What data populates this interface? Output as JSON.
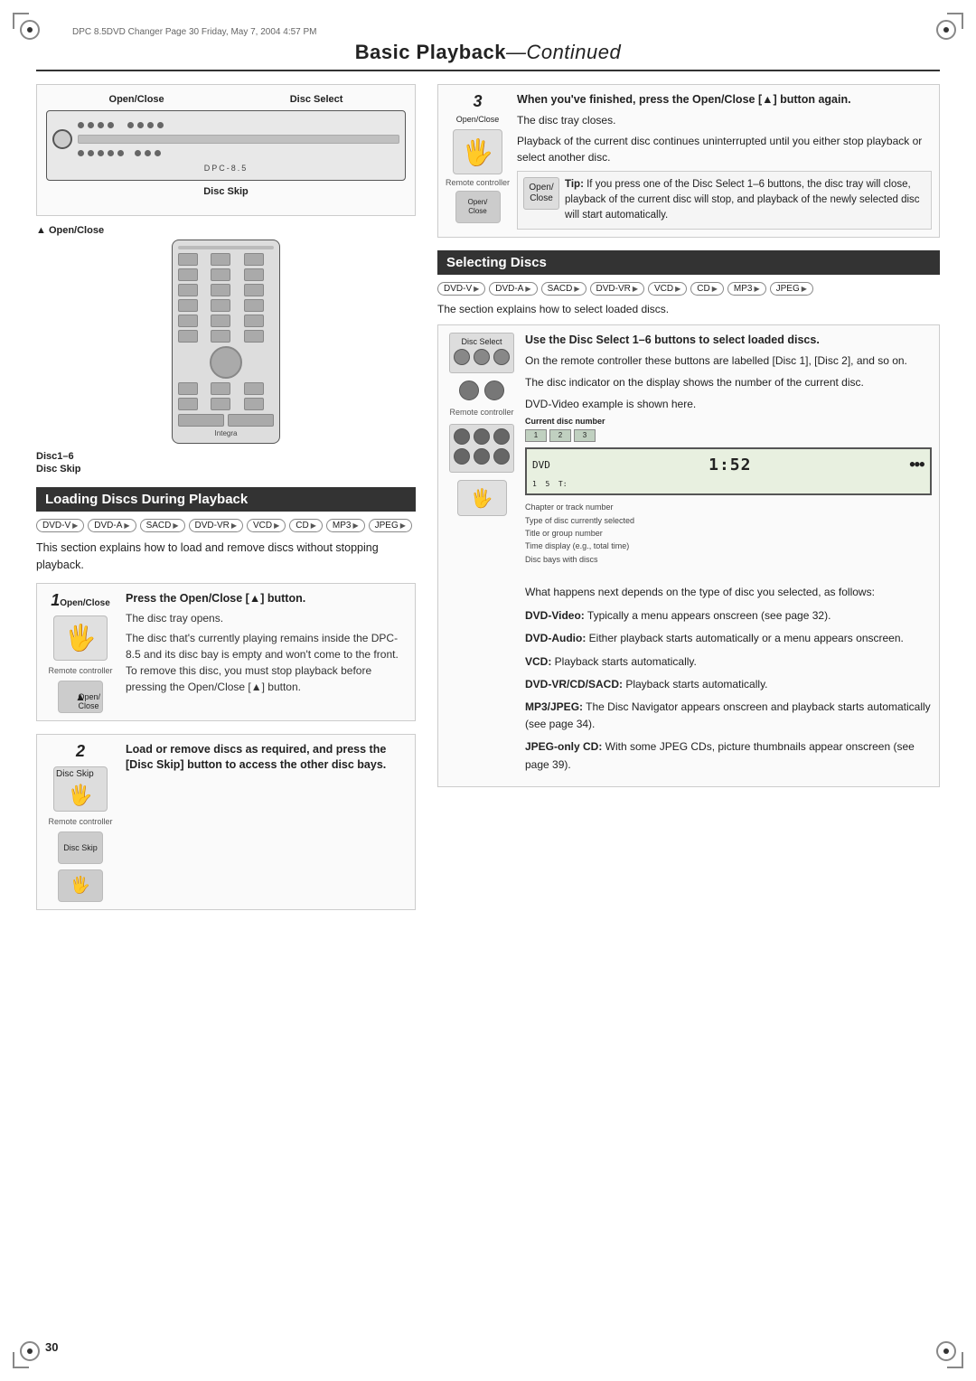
{
  "meta": {
    "header": "DPC 8.5DVD Changer  Page 30  Friday, May 7, 2004  4:57 PM"
  },
  "page_title": "Basic Playback",
  "page_title_suffix": "—Continued",
  "page_number": "30",
  "device_diagram": {
    "label_open_close": "Open/Close",
    "label_disc_select": "Disc Select",
    "label_disc_skip": "Disc Skip",
    "label_open_close_left": "▲ Open/Close",
    "label_disc1_6": "Disc1–6",
    "label_disc_skip_left": "Disc Skip"
  },
  "loading_section": {
    "title": "Loading Discs During Playback",
    "formats": [
      "DVD-V",
      "DVD-A",
      "SACD",
      "DVD-VR",
      "VCD",
      "CD",
      "MP3",
      "JPEG"
    ],
    "intro": "This section explains how to load and remove discs without stopping playback.",
    "steps": [
      {
        "number": "1",
        "icon_label": "Open/Close",
        "remote_label": "Remote controller",
        "title": "Press the Open/Close [▲] button.",
        "body_lines": [
          "The disc tray opens.",
          "The disc that's currently playing remains inside the DPC-8.5 and its disc bay is empty and won't come to the front. To remove this disc, you must stop playback before pressing the Open/Close [▲] button."
        ]
      },
      {
        "number": "2",
        "icon_label": "Disc Skip",
        "remote_label": "Remote controller",
        "remote_label2": "Disc Skip",
        "title": "Load or remove discs as required, and press the [Disc Skip] button to access the other disc bays.",
        "body_lines": []
      }
    ]
  },
  "right_col": {
    "step3": {
      "number": "3",
      "icon_label": "Open/Close",
      "remote_label": "Remote controller",
      "open_close_label": "Open/ Close",
      "title": "When you've finished, press the Open/Close [▲] button again.",
      "body": "The disc tray closes.",
      "body2": "Playback of the current disc continues uninterrupted until you either stop playback or select another disc.",
      "tip_title": "Tip:",
      "tip_body": "If you press one of the Disc Select 1–6 buttons, the disc tray will close, playback of the current disc will stop, and playback of the newly selected disc will start automatically."
    },
    "selecting_section": {
      "title": "Selecting Discs",
      "formats": [
        "DVD-V",
        "DVD-A",
        "SACD",
        "DVD-VR",
        "VCD",
        "CD",
        "MP3",
        "JPEG"
      ],
      "intro": "The section explains how to select loaded discs.",
      "step_title": "Use the Disc Select 1–6 buttons to select loaded discs.",
      "step_body": "On the remote controller these buttons are labelled [Disc 1], [Disc 2], and so on.",
      "display_note1": "The disc indicator on the display shows the number of the current disc.",
      "display_note2": "DVD-Video example is shown here.",
      "current_disc_label": "Current disc number",
      "display_labels": {
        "chapter_track": "Chapter or track number",
        "disc_type": "Type of disc currently selected",
        "display_value": "1:5 2",
        "title_group": "Title or group number",
        "time_display": "Time display (e.g., total time)",
        "disc_bays": "Disc bays with discs"
      },
      "remote_label": "Remote controller",
      "playback_types": [
        {
          "type": "DVD-Video:",
          "desc": "Typically a menu appears onscreen (see page 32)."
        },
        {
          "type": "DVD-Audio:",
          "desc": "Either playback starts automatically or a menu appears onscreen."
        },
        {
          "type": "VCD:",
          "desc": "Playback starts automatically."
        },
        {
          "type": "DVD-VR/CD/SACD:",
          "desc": "Playback starts automatically."
        },
        {
          "type": "MP3/JPEG:",
          "desc": "The Disc Navigator appears onscreen and playback starts automatically (see page 34)."
        },
        {
          "type": "JPEG-only CD:",
          "desc": "With some JPEG CDs, picture thumbnails appear onscreen (see page 39)."
        }
      ],
      "what_happens": "What happens next depends on the type of disc you selected, as follows:"
    }
  }
}
